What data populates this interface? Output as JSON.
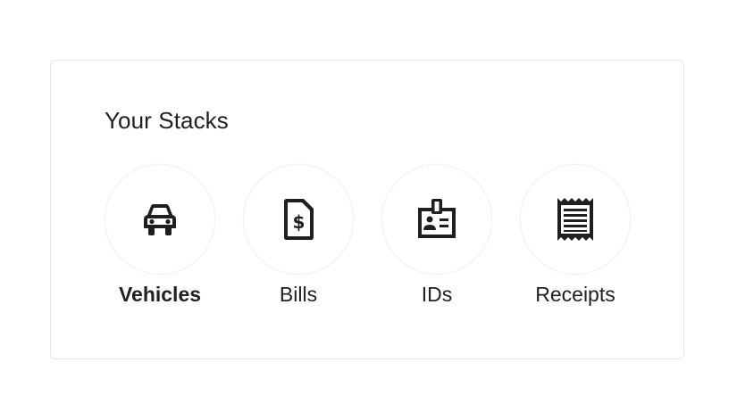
{
  "card": {
    "title": "Your Stacks"
  },
  "stacks": [
    {
      "label": "Vehicles",
      "icon": "car-icon",
      "selected": true
    },
    {
      "label": "Bills",
      "icon": "bill-dollar-icon",
      "selected": false
    },
    {
      "label": "IDs",
      "icon": "id-badge-icon",
      "selected": false
    },
    {
      "label": "Receipts",
      "icon": "receipt-icon",
      "selected": false
    }
  ],
  "colors": {
    "text": "#202124",
    "icon": "#1f1f1f",
    "card_border": "#e6e6e6",
    "circle_border": "#f1f1f1"
  }
}
